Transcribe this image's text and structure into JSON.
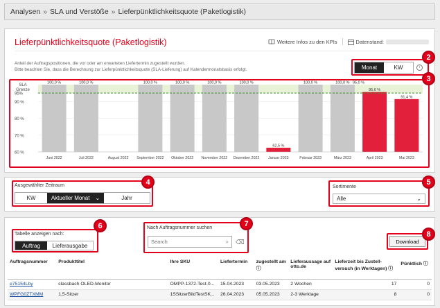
{
  "breadcrumb": [
    "Analysen",
    "SLA und Verstöße",
    "Lieferpünktlichkeitsquote (Paketlogistik)"
  ],
  "page_title": "Lieferpünktlichkeitsquote (Paketlogistik)",
  "top_links": {
    "more_info": "Weitere Infos zu den KPIs",
    "data_date": "Datenstand:"
  },
  "description": [
    "Anteil der Auftragspositionen, die vor oder am erwarteten Liefertermin zugestellt wurden.",
    "Bitte beachten Sie, dass die Berechnung zur Lieferpünktlichkeitsquote (SLA-Lieferung) auf Kalendermonatsbasis erfolgt."
  ],
  "granularity": {
    "options": [
      "Monat",
      "KW"
    ],
    "selected": "Monat"
  },
  "badges": [
    "2",
    "3",
    "4",
    "5",
    "6",
    "7",
    "8"
  ],
  "chart_data": {
    "type": "bar",
    "categories": [
      "Juni 2022",
      "Juli 2022",
      "August 2022",
      "September 2022",
      "Oktober 2022",
      "November 2022",
      "Dezember 2022",
      "Januar 2023",
      "Februar 2023",
      "März 2023",
      "April 2023",
      "Mai 2023"
    ],
    "values": [
      100.0,
      100.0,
      null,
      100.0,
      100.0,
      100.0,
      100.0,
      62.5,
      100.0,
      100.0,
      95.6,
      91.4
    ],
    "value_labels": [
      "100,0 %",
      "100,0 %",
      "",
      "100,0 %",
      "100,0 %",
      "100,0 %",
      "100,0 %",
      "62,5 %",
      "100,0 %",
      "100,0 %",
      "95,6 %",
      "91,4 %"
    ],
    "highlight": [
      false,
      false,
      false,
      false,
      false,
      false,
      false,
      true,
      false,
      false,
      true,
      true
    ],
    "y_ticks": [
      "95%",
      "90 %",
      "80 %",
      "70 %",
      "60 %"
    ],
    "y_tick_values": [
      95,
      90,
      80,
      70,
      60
    ],
    "ylim": [
      60,
      100
    ],
    "sla_label": [
      "SLA",
      "Grenze"
    ],
    "sla_value": 95,
    "sla_value_label": "95,0 %",
    "colors": {
      "normal": "#c8c8c8",
      "highlight": "#e2203b",
      "sla_band": "#e7f2d7",
      "sla_line": "#3d8c2c"
    }
  },
  "period": {
    "label": "Ausgewählter Zeitraum",
    "options": [
      "KW",
      "Aktueller Monat",
      "Jahr"
    ],
    "selected": "Aktueller Monat"
  },
  "sortiment": {
    "label": "Sortimente",
    "value": "Alle"
  },
  "view": {
    "label": "Tabelle anzeigen nach:",
    "options": [
      "Auftrag",
      "Lieferausgabe"
    ],
    "selected": "Auftrag"
  },
  "search": {
    "label": "Nach Auftragsnummer suchen",
    "placeholder": "Search"
  },
  "download_label": "Download",
  "table": {
    "headers": [
      "Auftragsnummer",
      "Produkttitel",
      "Ihre SKU",
      "Liefertermin",
      "zugestellt am",
      "Lieferaussage auf otto.de",
      "Lieferzeit bis Zustell-versuch (in Werktagen)",
      "Pünktlich"
    ],
    "rows": [
      [
        "e75154Lby",
        "classbach OLED-Monitor",
        "OMPP-1372-Test-0...",
        "15.04.2023",
        "03.05.2023",
        "2 Wochen",
        "17",
        "0"
      ],
      [
        "WPFG0ZTXMM",
        "1,5-Sitzer",
        "1SSitzerBildTestSK...",
        "26.04.2023",
        "05.05.2023",
        "2-3 Werktage",
        "8",
        "0"
      ]
    ]
  }
}
